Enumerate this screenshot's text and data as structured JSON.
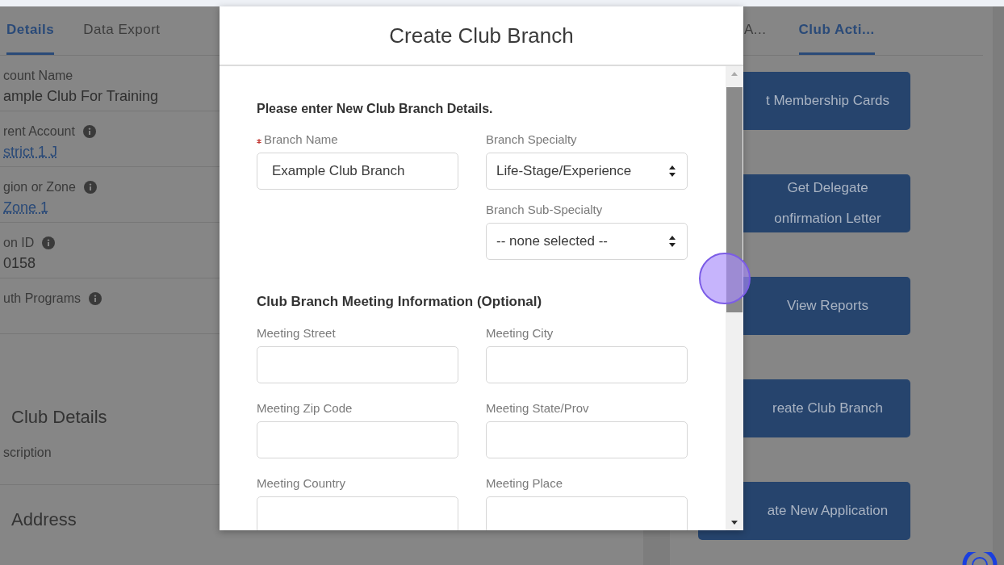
{
  "left_tabs": [
    {
      "label": "Details",
      "selected": true
    },
    {
      "label": "Data Export",
      "selected": false
    }
  ],
  "left_fields": [
    {
      "label": "count Name",
      "info": false,
      "value": "ample Club For Training",
      "link": false
    },
    {
      "label": "rent Account",
      "info": true,
      "value": "strict 1 J",
      "link": true
    },
    {
      "label": "gion or Zone",
      "info": true,
      "value": "Zone 1",
      "link": true
    },
    {
      "label": "on ID",
      "info": true,
      "value": "0158",
      "link": false
    },
    {
      "label": "uth Programs",
      "info": true
    }
  ],
  "left_sections": [
    {
      "title": "Club Details",
      "fields": [
        "scription"
      ]
    },
    {
      "title": "Address"
    }
  ],
  "right_tabs": [
    {
      "label": "A...",
      "selected": false
    },
    {
      "label": "Club Acti...",
      "selected": true
    }
  ],
  "action_buttons": [
    {
      "lines": [
        "t Membership Cards"
      ]
    },
    {
      "lines": [
        "Get Delegate",
        "onfirmation Letter"
      ]
    },
    {
      "lines": [
        "View Reports"
      ]
    },
    {
      "lines": [
        "reate Club Branch"
      ]
    },
    {
      "lines": [
        "ate New Application"
      ]
    }
  ],
  "modal": {
    "title": "Create Club Branch",
    "intro": "Please enter New Club Branch Details.",
    "left_fields": [
      {
        "kind": "text",
        "label": "Branch Name",
        "required": true,
        "value": "Example Club Branch"
      }
    ],
    "right_fields": [
      {
        "kind": "select",
        "label": "Branch Specialty",
        "required": false,
        "value": "Life-Stage/Experience"
      },
      {
        "kind": "select",
        "label": "Branch Sub-Specialty",
        "required": false,
        "value": "-- none selected --"
      }
    ],
    "meeting_heading": "Club Branch Meeting Information (Optional)",
    "meeting_fields": [
      {
        "kind": "text",
        "label": "Meeting Street",
        "required": false
      },
      {
        "kind": "text",
        "label": "Meeting City",
        "required": false
      },
      {
        "kind": "text",
        "label": "Meeting Zip Code",
        "required": false
      },
      {
        "kind": "text",
        "label": "Meeting State/Prov",
        "required": false
      },
      {
        "kind": "text",
        "label": "Meeting Country",
        "required": false
      },
      {
        "kind": "text",
        "label": "Meeting Place",
        "required": false
      }
    ]
  }
}
